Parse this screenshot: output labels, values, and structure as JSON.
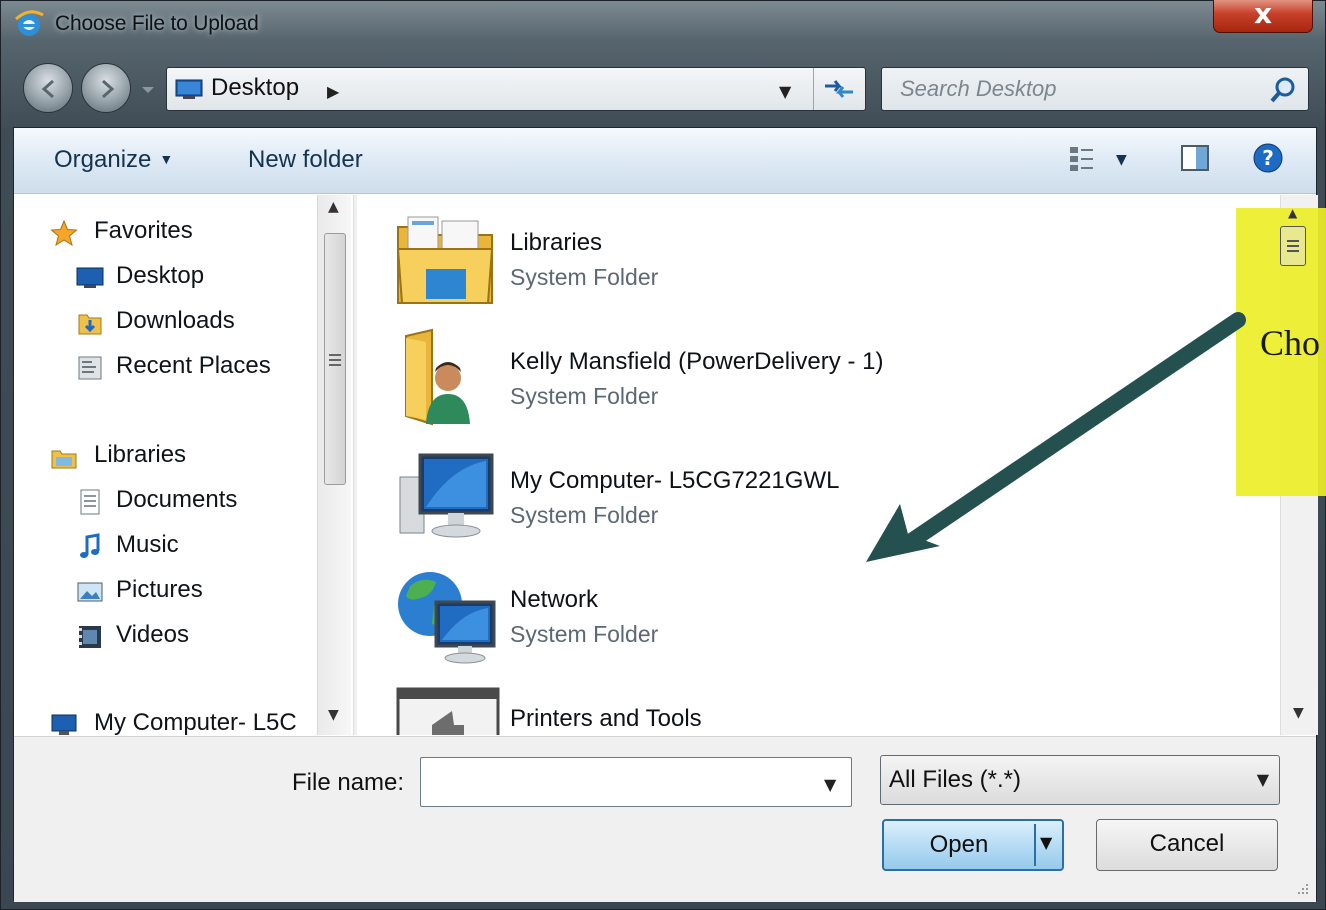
{
  "window": {
    "title": "Choose File to Upload",
    "close_label": "x"
  },
  "address": {
    "location": "Desktop",
    "separator": "▶"
  },
  "search": {
    "placeholder": "Search Desktop"
  },
  "toolbar": {
    "organize_label": "Organize",
    "new_folder_label": "New folder"
  },
  "sidebar": {
    "favorites": "Favorites",
    "favorites_items": [
      "Desktop",
      "Downloads",
      "Recent Places"
    ],
    "libraries": "Libraries",
    "libraries_items": [
      "Documents",
      "Music",
      "Pictures",
      "Videos"
    ],
    "computer": "My Computer- L5C"
  },
  "files": [
    {
      "name": "Libraries",
      "type": "System Folder",
      "icon": "libraries-folder-icon"
    },
    {
      "name": "Kelly Mansfield (PowerDelivery - 1)",
      "type": "System Folder",
      "icon": "user-folder-icon"
    },
    {
      "name": "My Computer- L5CG7221GWL",
      "type": "System Folder",
      "icon": "computer-icon"
    },
    {
      "name": "Network",
      "type": "System Folder",
      "icon": "network-icon"
    },
    {
      "name": "Printers and Tools",
      "type": "",
      "icon": "printer-icon"
    }
  ],
  "bottom": {
    "file_name_label": "File name:",
    "file_name_value": "",
    "file_type_selected": "All Files (*.*)",
    "open_label": "Open",
    "cancel_label": "Cancel"
  },
  "overlay": {
    "partial_text": "Cho"
  },
  "colors": {
    "accent": "#2a6fa5",
    "overlay_highlight": "#eceea8",
    "annotation_arrow": "#24504f"
  }
}
